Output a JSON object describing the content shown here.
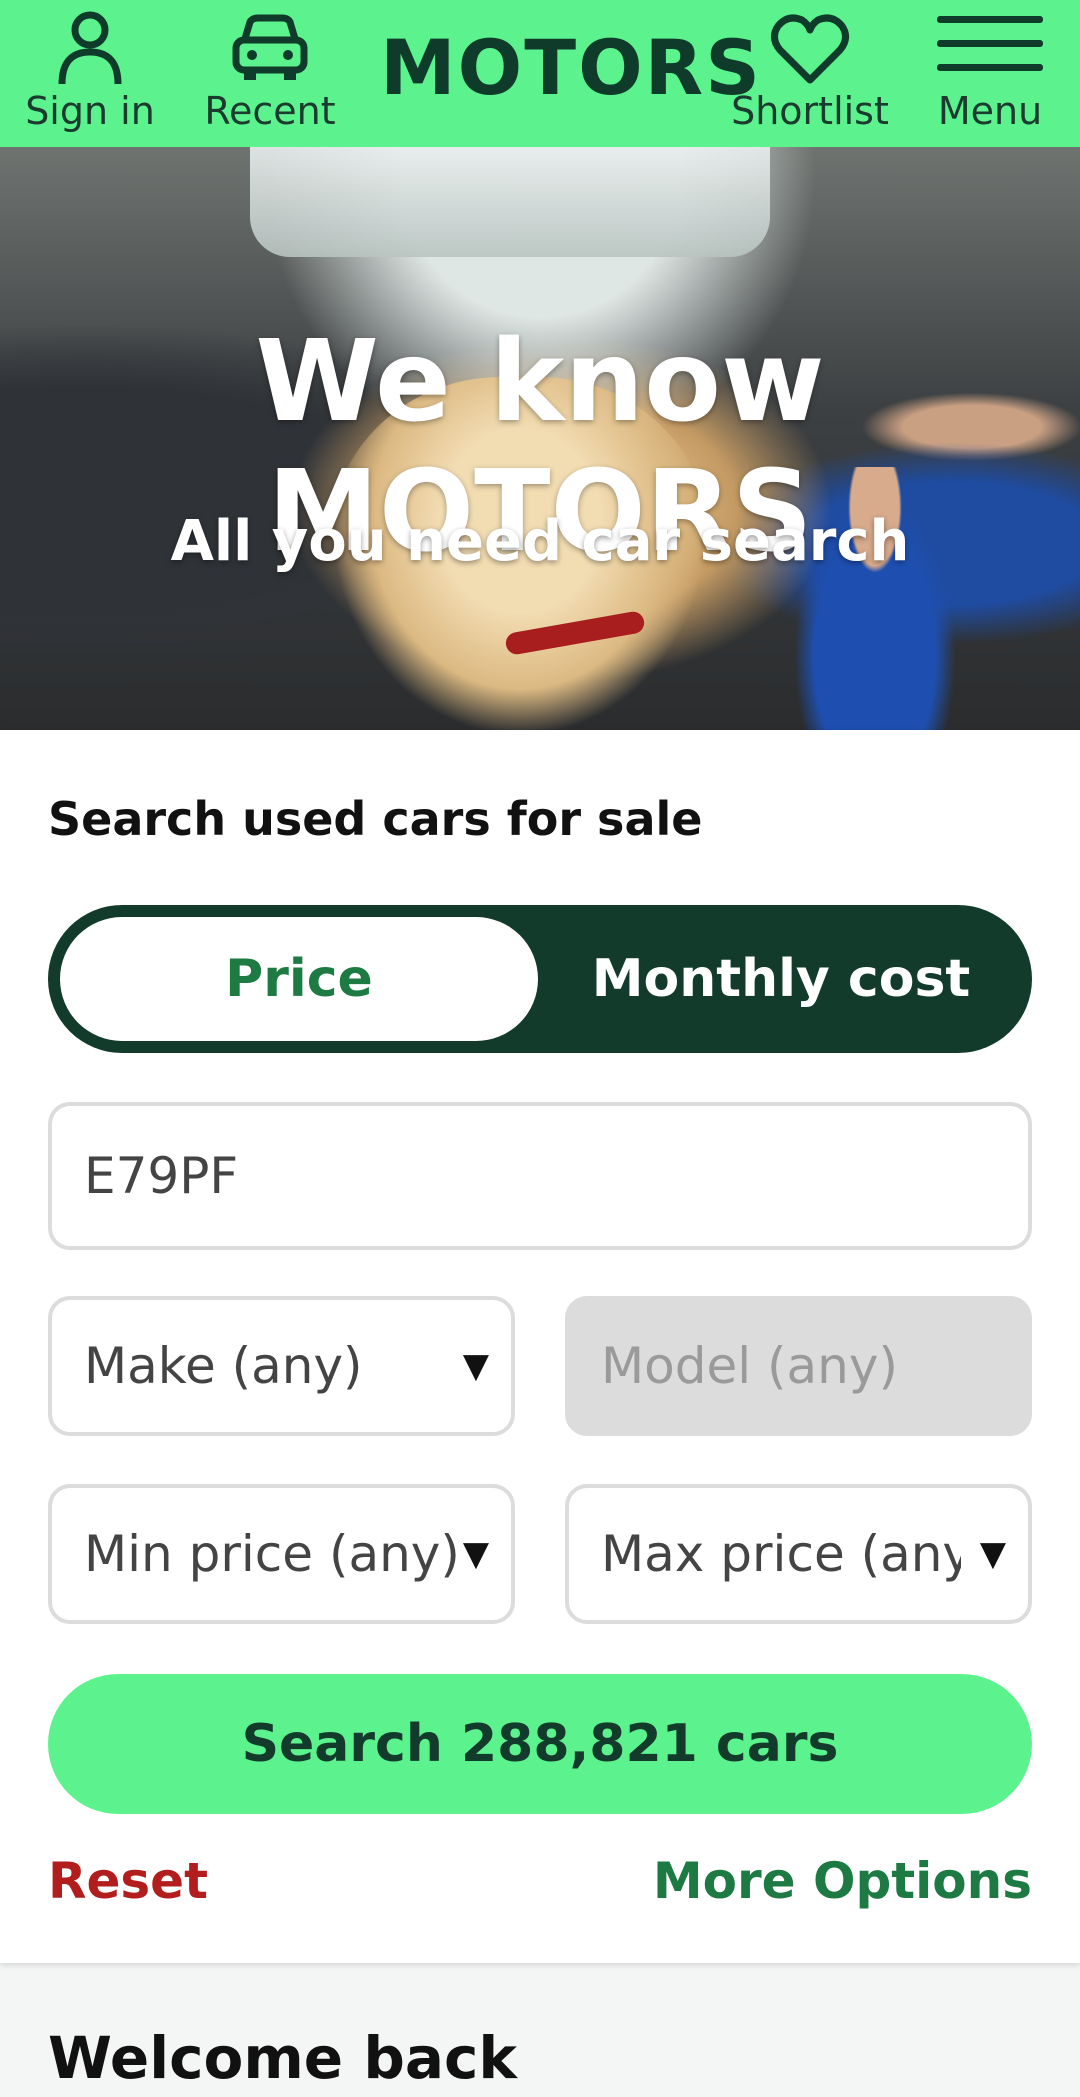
{
  "header": {
    "sign_in_label": "Sign in",
    "recent_label": "Recent",
    "logo_text": "MOTORS",
    "shortlist_label": "Shortlist",
    "menu_label": "Menu"
  },
  "hero": {
    "title": "We know MOTORS",
    "subtitle": "All you need car search"
  },
  "search": {
    "title": "Search used cars for sale",
    "toggle": {
      "price": "Price",
      "monthly": "Monthly cost"
    },
    "postcode_value": "E79PF",
    "make_value": "Make (any)",
    "model_value": "Model (any)",
    "min_price_value": "Min price (any)",
    "max_price_value": "Max price (any)",
    "search_button": "Search 288,821 cars",
    "reset_label": "Reset",
    "more_options_label": "More Options"
  },
  "welcome": {
    "title": "Welcome back"
  },
  "colors": {
    "brand_green": "#5cf38f",
    "dark_green": "#133b2c",
    "accent_green": "#1e7a43",
    "reset_red": "#b21d1d"
  }
}
